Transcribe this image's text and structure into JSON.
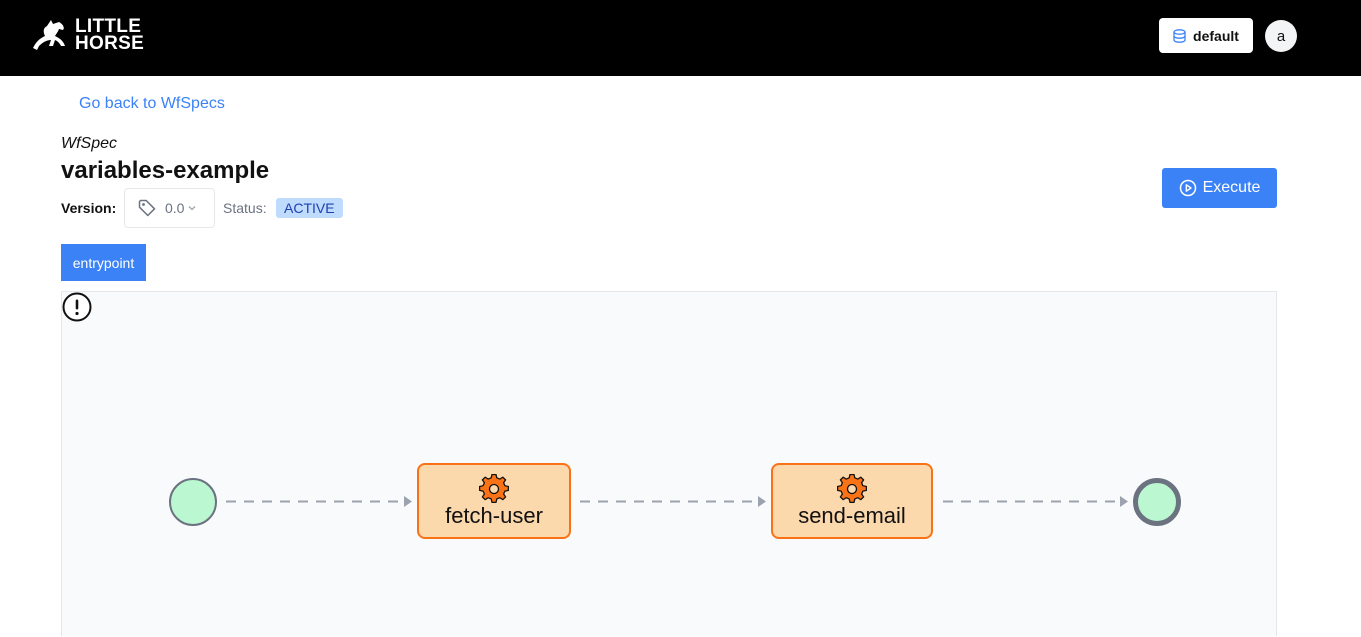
{
  "header": {
    "logo_line1": "LITTLE",
    "logo_line2": "HORSE",
    "tenant": "default",
    "avatar_initial": "a"
  },
  "nav": {
    "back_link": "Go back to WfSpecs"
  },
  "spec": {
    "type_label": "WfSpec",
    "title": "variables-example",
    "version_label": "Version:",
    "version_value": "0.0",
    "status_label": "Status:",
    "status_value": "ACTIVE",
    "execute_label": "Execute"
  },
  "threads": [
    {
      "label": "entrypoint"
    }
  ],
  "diagram": {
    "nodes": [
      {
        "id": "start",
        "kind": "entrypoint"
      },
      {
        "id": "fetch-user",
        "kind": "task",
        "label": "fetch-user",
        "icon": "gear-icon"
      },
      {
        "id": "send-email",
        "kind": "task",
        "label": "send-email",
        "icon": "gear-icon"
      },
      {
        "id": "end",
        "kind": "exit"
      }
    ],
    "edges": [
      {
        "from": "start",
        "to": "fetch-user"
      },
      {
        "from": "fetch-user",
        "to": "send-email",
        "icon": "exclamation-circle-icon"
      },
      {
        "from": "send-email",
        "to": "end"
      }
    ]
  },
  "colors": {
    "topbar": "#000000",
    "accent": "#3b82f6",
    "task_fill": "#fcd8ad",
    "task_border": "#f97316",
    "terminal_fill": "#bbf7d0"
  }
}
